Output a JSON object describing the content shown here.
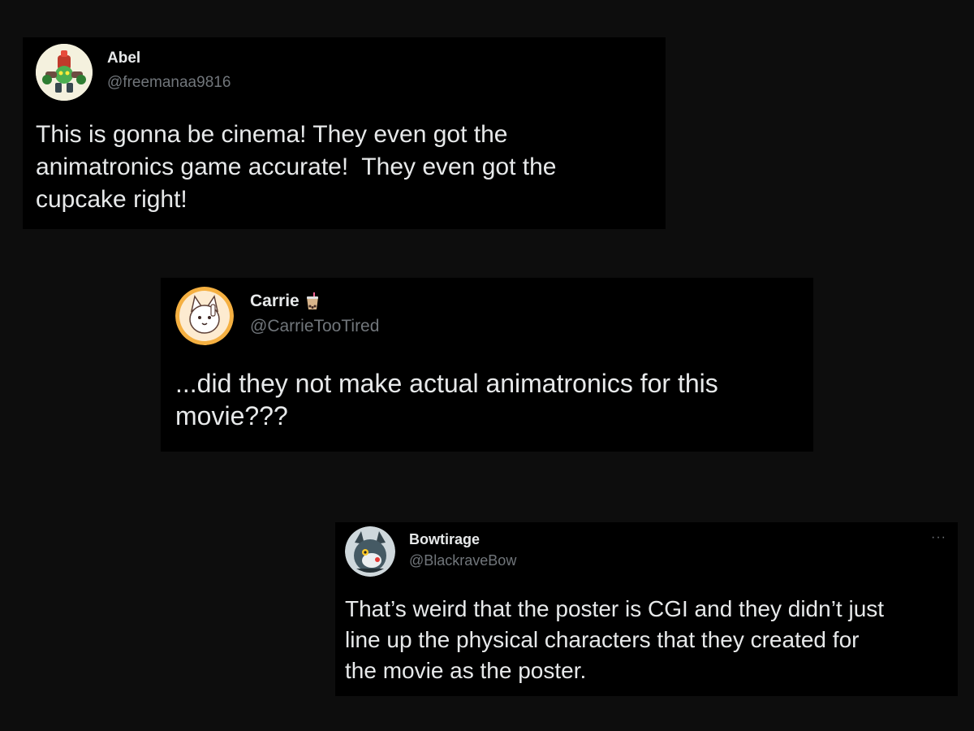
{
  "tweets": [
    {
      "display_name": "Abel",
      "handle": "@freemanaa9816",
      "text": "This is gonna be cinema! They even got the\nanimatronics game accurate!  They even got the\ncupcake right!",
      "avatar_icon": "green-robot-avatar"
    },
    {
      "display_name": "Carrie",
      "handle": "@CarrieTooTired",
      "text": "...did they not make actual animatronics for this\nmovie???",
      "avatar_icon": "cartoon-cat-avatar",
      "name_emoji": "bubble-tea-icon"
    },
    {
      "display_name": "Bowtirage",
      "handle": "@BlackraveBow",
      "text": "That’s weird that the poster is CGI and they didn’t just\nline up the physical characters that they created for\nthe movie as the poster.",
      "avatar_icon": "dark-creature-avatar",
      "more_icon": "···"
    }
  ],
  "colors": {
    "page_background": "#0d0d0d",
    "card_background": "#000000",
    "primary_text": "#e7e9ea",
    "secondary_text": "#71767b"
  }
}
